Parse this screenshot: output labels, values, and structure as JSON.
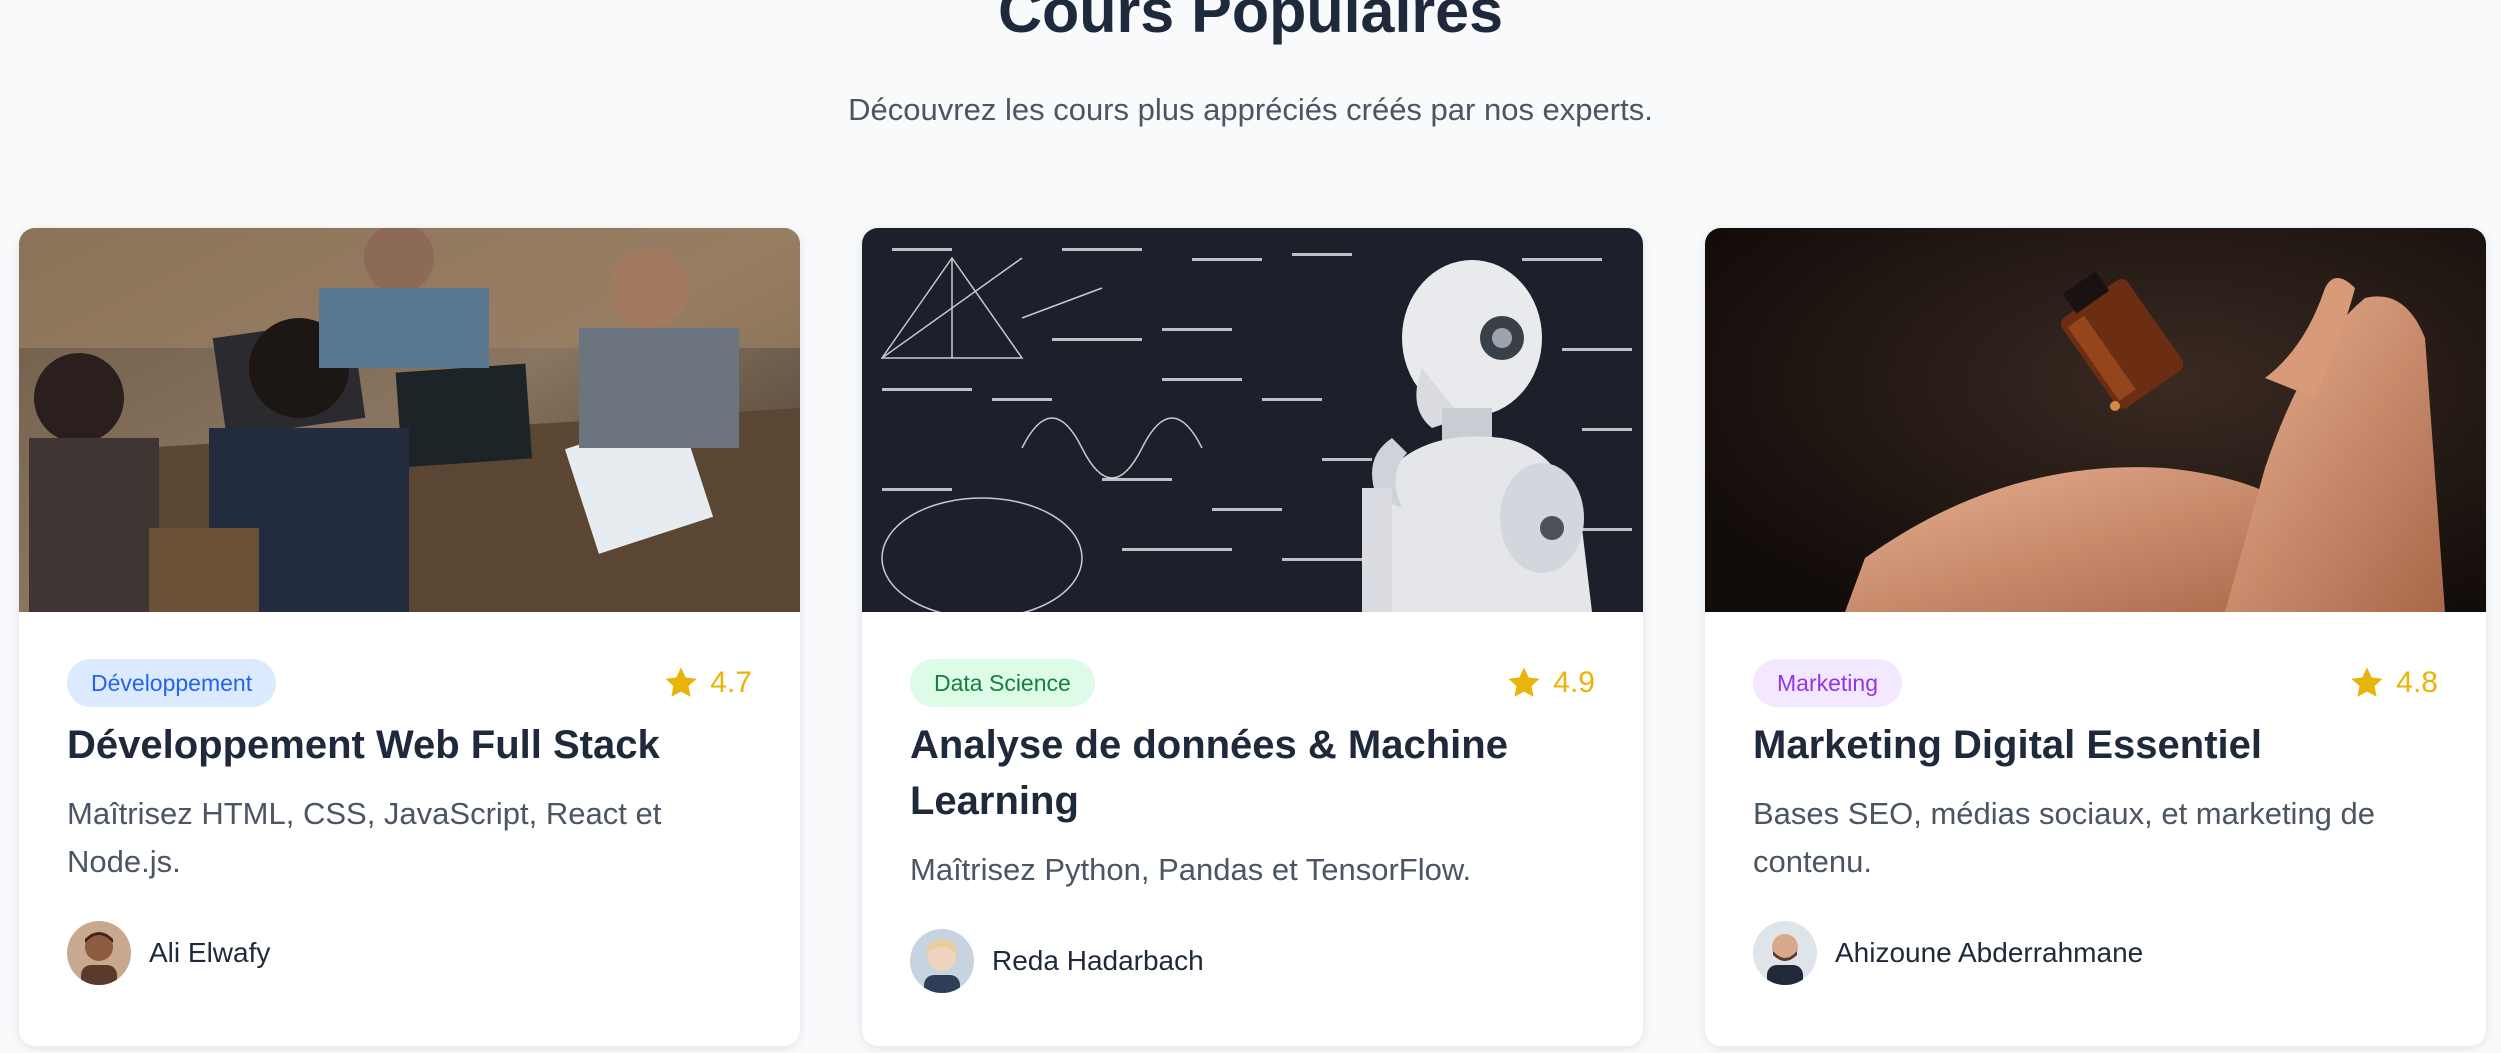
{
  "section": {
    "title": "Cours Populaires",
    "subtitle": "Découvrez les cours plus appréciés créés par nos experts."
  },
  "courses": [
    {
      "category": "Développement",
      "category_bg": "#dbeafe",
      "category_color": "#2563eb",
      "rating": "4.7",
      "title": "Développement Web Full Stack",
      "description": "Maîtrisez HTML, CSS, JavaScript, React et Node.js.",
      "instructor": "Ali Elwafy",
      "image": "students-with-laptops-photo"
    },
    {
      "category": "Data Science",
      "category_bg": "#dcfce7",
      "category_color": "#15803d",
      "rating": "4.9",
      "title": "Analyse de données & Machine Learning",
      "description": "Maîtrisez Python, Pandas et TensorFlow.",
      "instructor": "Reda Hadarbach",
      "image": "robot-chalkboard-photo"
    },
    {
      "category": "Marketing",
      "category_bg": "#f3e8ff",
      "category_color": "#9333ea",
      "rating": "4.8",
      "title": "Marketing Digital Essentiel",
      "description": "Bases SEO, médias sociaux, et marketing de contenu.",
      "instructor": "Ahizoune Abderrahmane",
      "image": "dropper-bottle-hand-photo"
    }
  ],
  "colors": {
    "star": "#eab308",
    "title": "#1e293b",
    "text": "#4b5563"
  }
}
